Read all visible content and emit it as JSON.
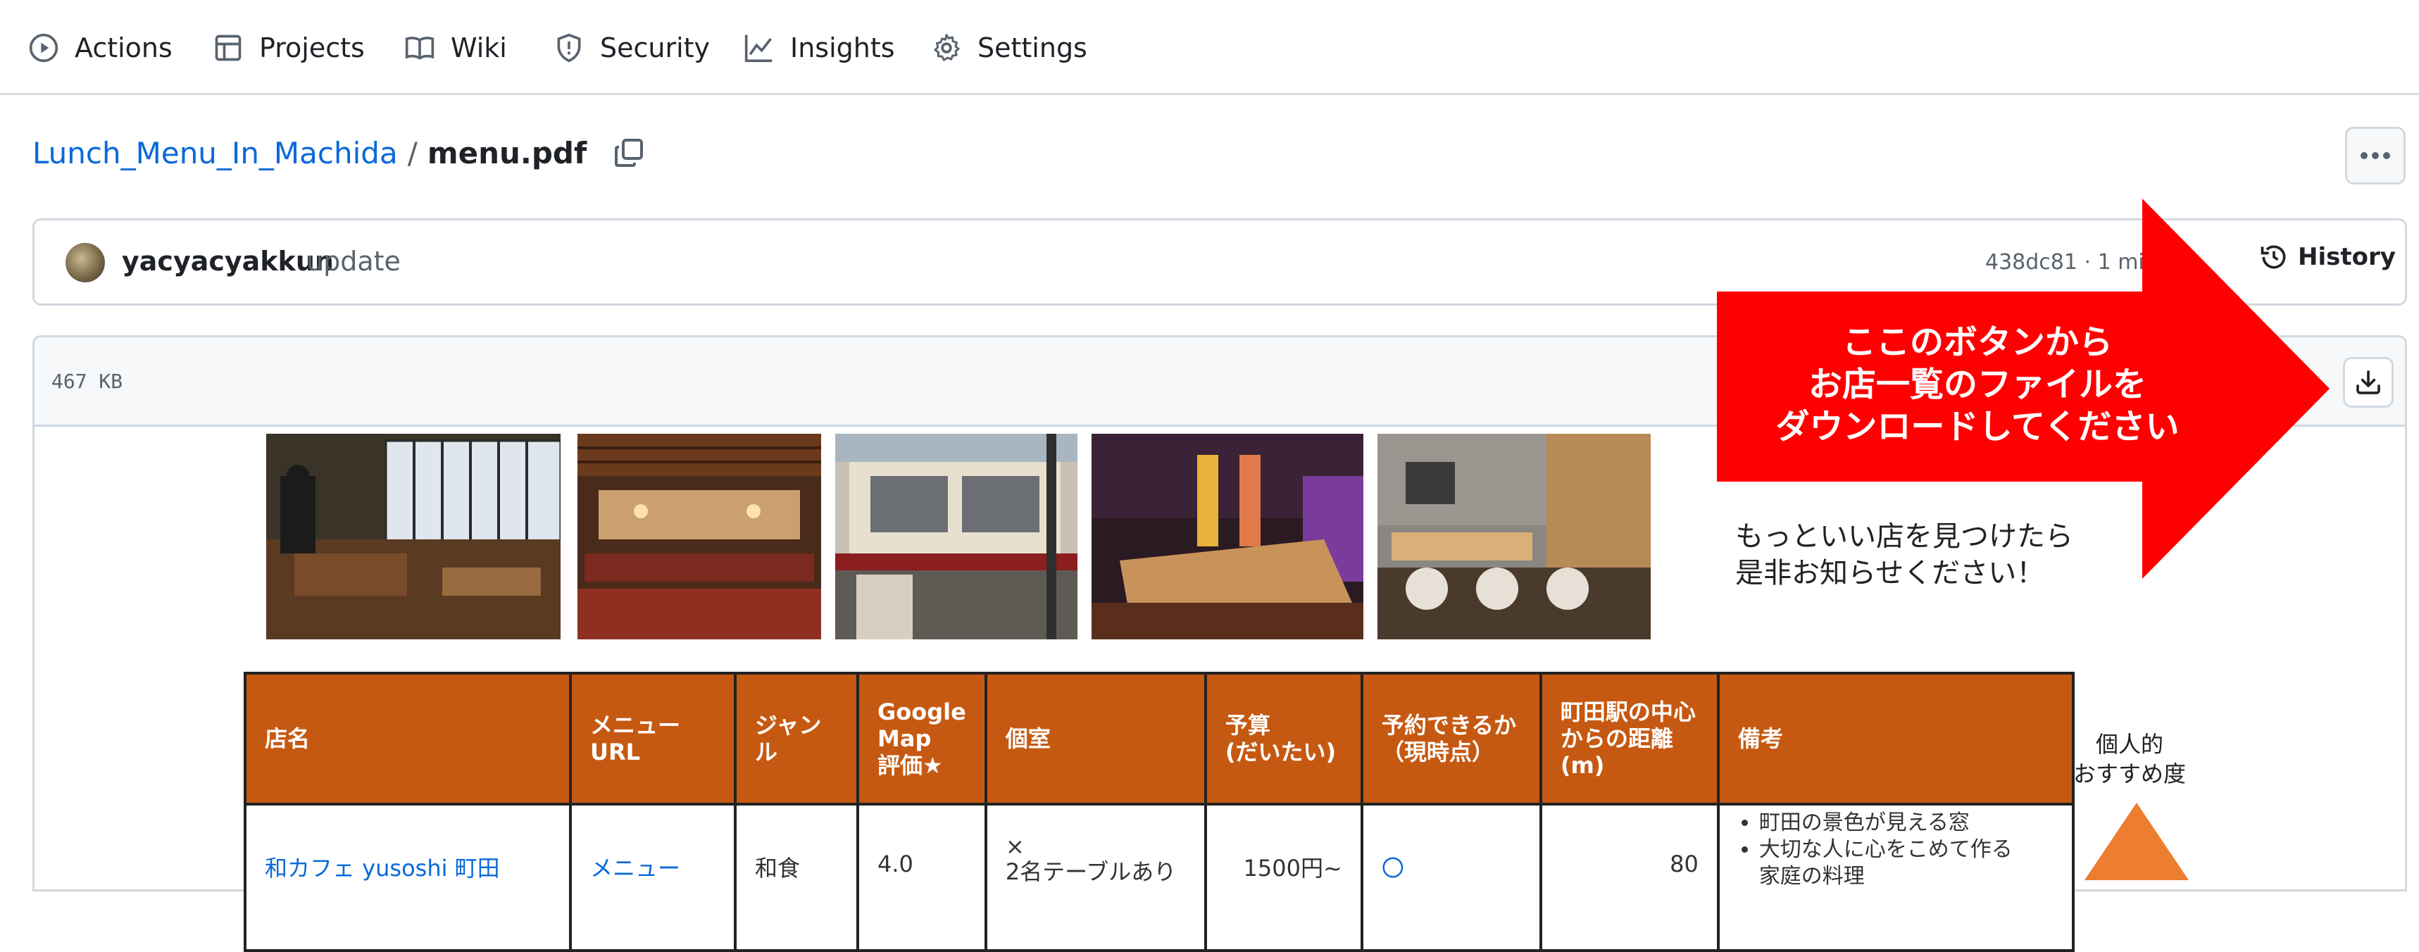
{
  "nav": {
    "items": [
      {
        "label": "Actions",
        "icon": "play-circle-icon"
      },
      {
        "label": "Projects",
        "icon": "table-icon"
      },
      {
        "label": "Wiki",
        "icon": "book-icon"
      },
      {
        "label": "Security",
        "icon": "shield-icon"
      },
      {
        "label": "Insights",
        "icon": "graph-icon"
      },
      {
        "label": "Settings",
        "icon": "gear-icon"
      }
    ]
  },
  "breadcrumb": {
    "repo": "Lunch_Menu_In_Machida",
    "separator": "/",
    "file": "menu.pdf"
  },
  "commit": {
    "author": "yacyacyakkun",
    "message": "update",
    "meta": "438dc81 · 1 min ago",
    "history_label": "History"
  },
  "file": {
    "size": "467 KB"
  },
  "pdf": {
    "tip_lines": [
      "もっといい店を見つけたら",
      "是非お知らせください！"
    ],
    "headers": [
      [
        "店名"
      ],
      [
        "メニュー",
        "URL"
      ],
      [
        "ジャン",
        "ル"
      ],
      [
        "Google",
        "Map",
        "評価★"
      ],
      [
        "個室"
      ],
      [
        "予算",
        "(だいたい)"
      ],
      [
        "予約できるか",
        "（現時点）"
      ],
      [
        "町田駅の中心",
        "からの距離",
        "(m)"
      ],
      [
        "備考"
      ]
    ],
    "row": {
      "name": "和カフェ yusoshi 町田",
      "menu": "メニュー",
      "genre": "和食",
      "rating": "4.0",
      "room": "×",
      "room_note": "2名テーブルあり",
      "budget": "1500円~",
      "reservation": "〇",
      "distance": "80",
      "notes": [
        "町田の景色が見える窓",
        "大切な人に心をこめて作る",
        "家庭の料理"
      ]
    },
    "recommend_label_lines": [
      "個人的",
      "おすすめ度"
    ]
  },
  "annotation": {
    "lines": [
      "ここのボタンから",
      "お店一覧のファイルを",
      "ダウンロードしてください"
    ],
    "color": "#ff0000"
  }
}
